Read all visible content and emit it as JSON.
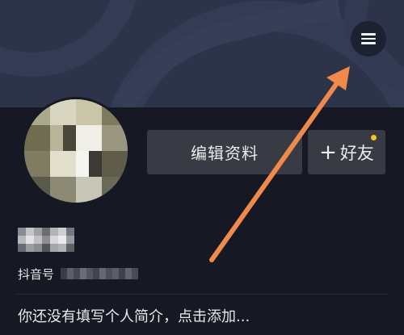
{
  "header": {
    "menu_icon": "hamburger-menu-icon"
  },
  "profile": {
    "avatar_icon": "user-avatar-pixelated",
    "edit_profile_label": "编辑资料",
    "add_friend_label": "好友",
    "add_friend_icon": "plus-icon",
    "notification_dot_color": "#f5c518",
    "id_label": "抖音号",
    "bio_placeholder": "你还没有填写个人简介，点击添加..."
  },
  "annotation": {
    "arrow_color": "#f0894a",
    "arrow_target": "hamburger-menu-icon"
  }
}
